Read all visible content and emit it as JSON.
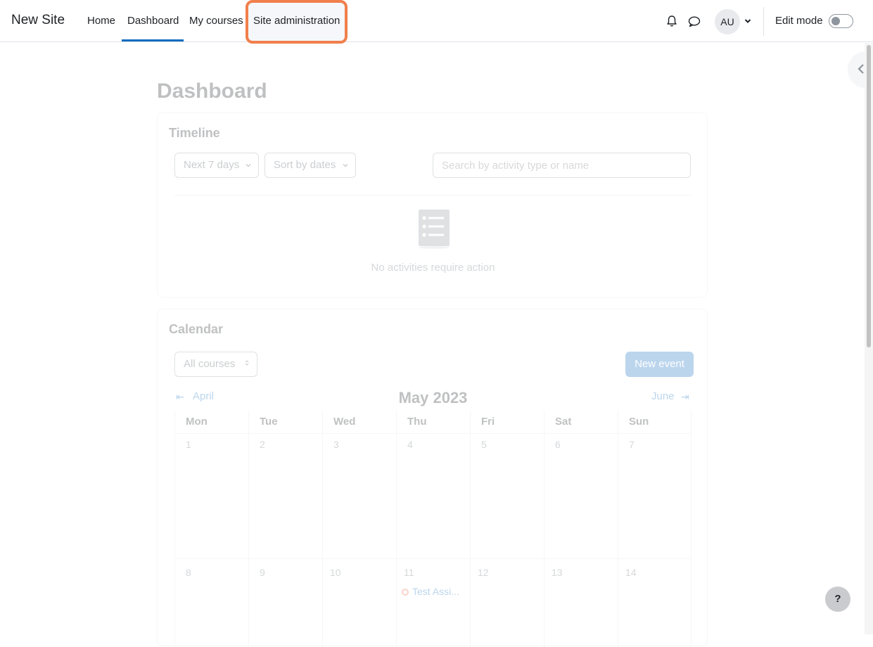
{
  "navbar": {
    "brand": "New Site",
    "items": [
      {
        "label": "Home"
      },
      {
        "label": "Dashboard",
        "active": true
      },
      {
        "label": "My courses"
      },
      {
        "label": "Site administration",
        "highlighted": true
      }
    ],
    "avatar_initials": "AU",
    "edit_mode_label": "Edit mode",
    "edit_mode_on": false,
    "icons": [
      "bell-icon",
      "chat-icon",
      "chevron-down-icon"
    ]
  },
  "page": {
    "title": "Dashboard"
  },
  "timeline": {
    "title": "Timeline",
    "filter_label": "Next 7 days",
    "sort_label": "Sort by dates",
    "search_placeholder": "Search by activity type or name",
    "empty_text": "No activities require action"
  },
  "calendar": {
    "title": "Calendar",
    "course_filter": "All courses",
    "new_event_label": "New event",
    "month_title": "May 2023",
    "prev_month": "April",
    "next_month": "June",
    "day_names": [
      "Mon",
      "Tue",
      "Wed",
      "Thu",
      "Fri",
      "Sat",
      "Sun"
    ],
    "weeks": [
      [
        "1",
        "2",
        "3",
        "4",
        "5",
        "6",
        "7"
      ],
      [
        "8",
        "9",
        "10",
        "11",
        "12",
        "13",
        "14"
      ]
    ],
    "event": {
      "label": "Test Assi...",
      "day": "11"
    }
  },
  "help_label": "?",
  "colors": {
    "accent": "#0f6cbf",
    "highlight": "#f07f4c",
    "event": "#f0673c"
  }
}
